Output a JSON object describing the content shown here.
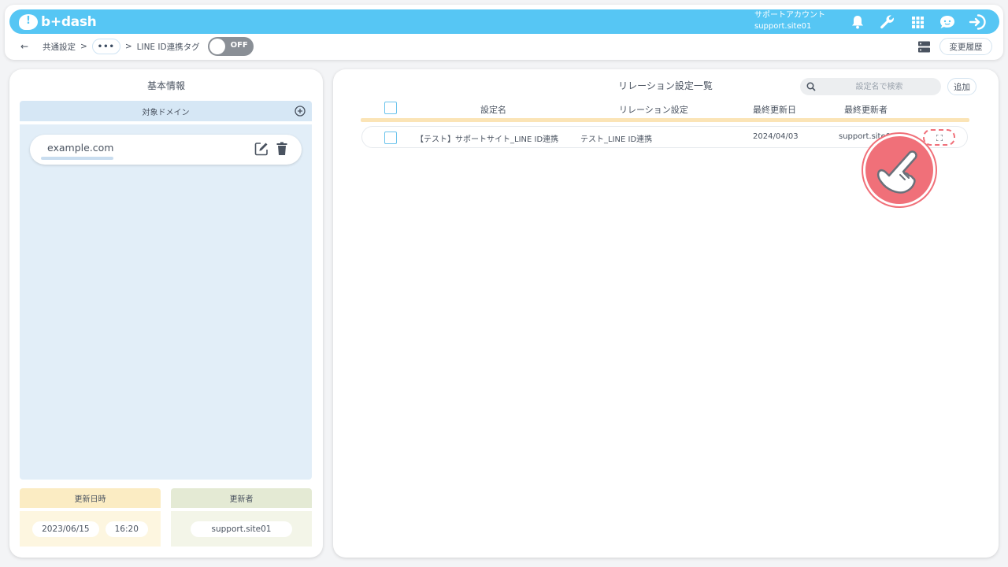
{
  "header": {
    "logo_text": "b+dash",
    "account_label": "サポートアカウント",
    "account_name": "support.site01",
    "icons": [
      "bell-icon",
      "wrench-icon",
      "grid-icon",
      "chat-face-icon",
      "logout-icon"
    ]
  },
  "breadcrumb": {
    "back": "←",
    "item1": "共通設定",
    "sep": ">",
    "more": "•••",
    "item2": "LINE ID連携タグ",
    "toggle_label": "OFF"
  },
  "toolbar": {
    "history_label": "変更履歴"
  },
  "left": {
    "title": "基本情報",
    "domain_header": "対象ドメイン",
    "domains": [
      {
        "name": "example.com"
      }
    ],
    "updated_at_label": "更新日時",
    "updated_date": "2023/06/15",
    "updated_time": "16:20",
    "updated_by_label": "更新者",
    "updated_by": "support.site01"
  },
  "right": {
    "title": "リレーション設定一覧",
    "search_placeholder": "設定名で検索",
    "add_label": "追加",
    "columns": [
      "設定名",
      "リレーション設定",
      "最終更新日",
      "最終更新者"
    ],
    "rows": [
      {
        "name": "【テスト】サポートサイト_LINE ID連携",
        "relation": "テスト_LINE ID連携",
        "updated": "2024/04/03",
        "updater": "support.site01"
      }
    ]
  },
  "colors": {
    "accent": "#56c6f4",
    "highlight": "#f07079",
    "panel_blue": "#e2eef8"
  }
}
